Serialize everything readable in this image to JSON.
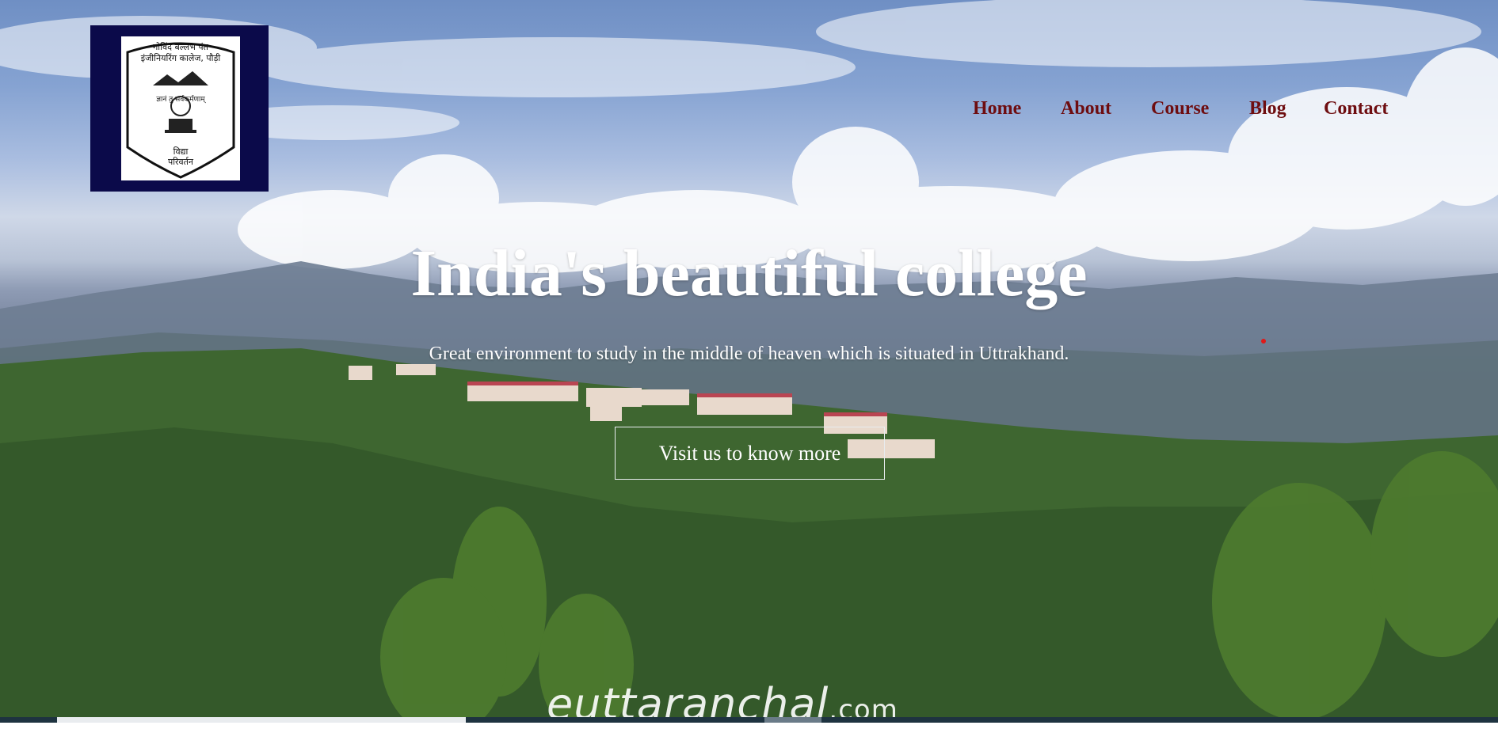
{
  "logo": {
    "line1": "गोविंद बल्लभ पंत",
    "line2": "इंजीनियरिंग कालेज, पौड़ी",
    "motto1": "विद्या",
    "motto2": "परिवर्तन",
    "ring_text": "ज्ञानं तु सर्वकर्मणाम्"
  },
  "nav": {
    "items": [
      {
        "label": "Home"
      },
      {
        "label": "About"
      },
      {
        "label": "Course"
      },
      {
        "label": "Blog"
      },
      {
        "label": "Contact"
      }
    ],
    "color": "#6e0d10"
  },
  "hero": {
    "title": "India's beautiful college",
    "subtitle": "Great environment to study in the middle of heaven which is situated in Uttrakhand.",
    "cta_label": "Visit us to know more"
  },
  "watermark": {
    "brand": "euttaranchal",
    "domain": ".com"
  }
}
